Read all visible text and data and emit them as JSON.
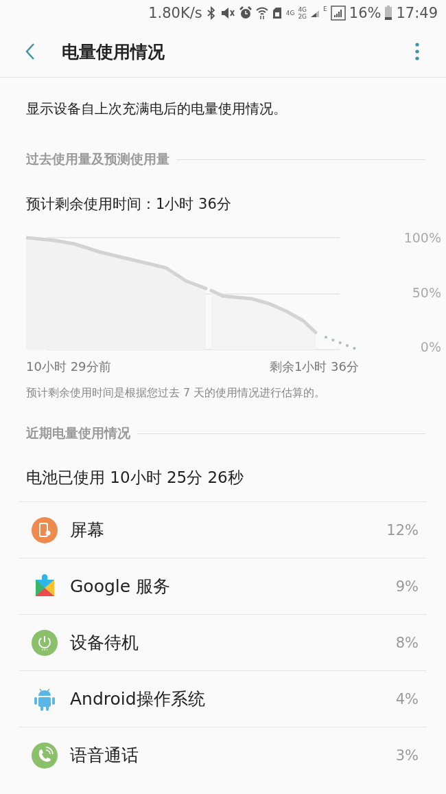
{
  "status_bar": {
    "speed": "1.80K/s",
    "network_1": "4G",
    "network_2_top": "4G",
    "network_2_bottom": "2G",
    "network_3": "E",
    "battery": "16%",
    "time": "17:49"
  },
  "header": {
    "title": "电量使用情况"
  },
  "description": "显示设备自上次充满电后的电量使用情况。",
  "past_section": {
    "title": "过去使用量及预测使用量",
    "estimate": "预计剩余使用时间：1小时 36分",
    "y_labels": [
      "100%",
      "50%",
      "0%"
    ],
    "x_start": "10小时 29分前",
    "x_end": "剩余1小时 36分",
    "note": "预计剩余使用时间是根据您过去 7 天的使用情况进行估算的。"
  },
  "recent_section": {
    "title": "近期电量使用情况",
    "used": "电池已使用 10小时 25分 26秒",
    "items": [
      {
        "kind": "screen",
        "name": "屏幕",
        "percent": "12%"
      },
      {
        "kind": "google",
        "name": "Google 服务",
        "percent": "9%"
      },
      {
        "kind": "standby",
        "name": "设备待机",
        "percent": "8%"
      },
      {
        "kind": "android",
        "name": "Android操作系统",
        "percent": "4%"
      },
      {
        "kind": "call",
        "name": "语音通话",
        "percent": "3%"
      }
    ]
  }
}
